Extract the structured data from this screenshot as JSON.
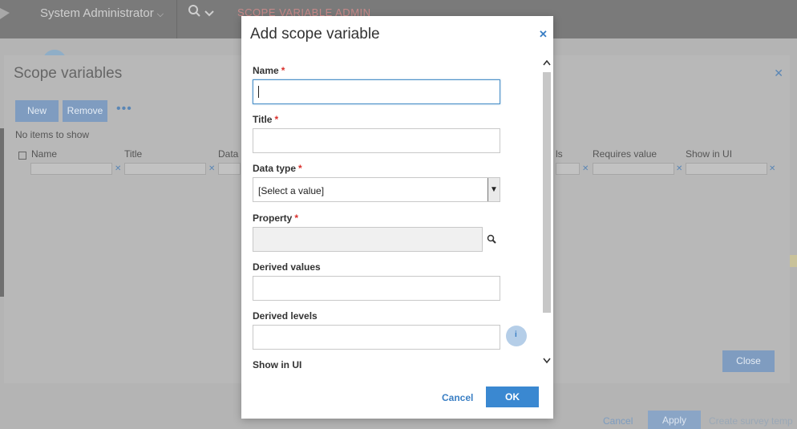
{
  "header": {
    "user_label": "System Administrator",
    "tenant_text": "SCOPE VARIABLE ADMIN"
  },
  "background_dialog": {
    "title": "Scope variables",
    "new_label": "New",
    "remove_label": "Remove",
    "more_label": "•••",
    "empty_text": "No items to show",
    "columns": [
      "Name",
      "Title",
      "Data",
      "ls",
      "Requires value",
      "Show in UI"
    ],
    "close_label": "Close"
  },
  "footer": {
    "cancel_label": "Cancel",
    "apply_label": "Apply",
    "create_label": "Create survey temp"
  },
  "modal": {
    "title": "Add scope variable",
    "fields": {
      "name_label": "Name",
      "title_label": "Title",
      "data_type_label": "Data type",
      "data_type_value": "[Select a value]",
      "property_label": "Property",
      "derived_values_label": "Derived values",
      "derived_levels_label": "Derived levels",
      "show_in_ui_label": "Show in UI",
      "required_marker": "*"
    },
    "cancel_label": "Cancel",
    "ok_label": "OK"
  },
  "colors": {
    "accent": "#3a88d1",
    "required": "#d9302c",
    "focus_border": "#4a90c8"
  }
}
